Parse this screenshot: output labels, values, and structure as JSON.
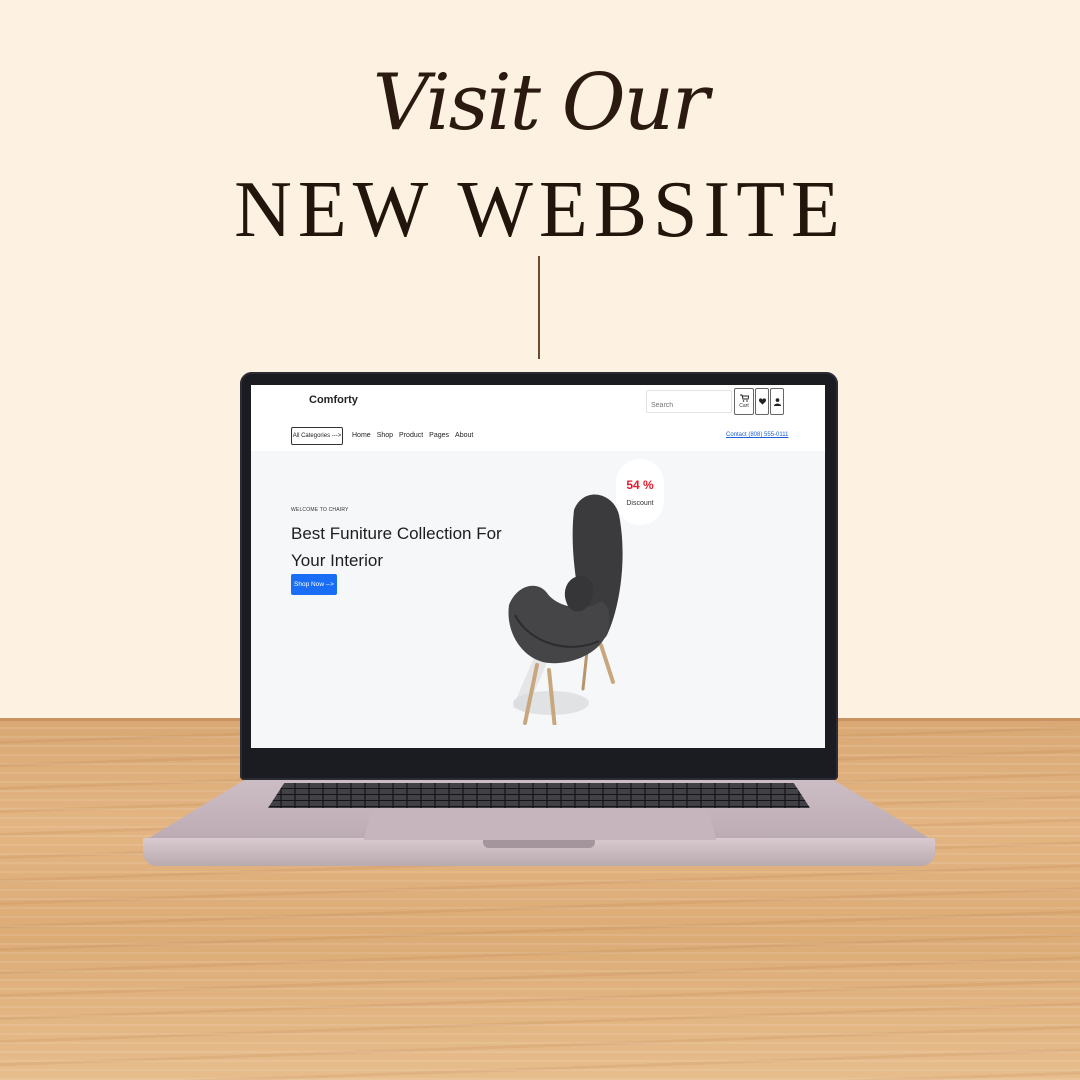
{
  "poster": {
    "headline_script": "Visit Our",
    "headline_caps": "NEW WEBSITE"
  },
  "website": {
    "logo": "Comforty",
    "search": {
      "placeholder": "Search"
    },
    "cart_label": "Cart",
    "icons": [
      "cart-icon",
      "heart-icon",
      "user-icon"
    ],
    "categories_button": "All Categories --->",
    "nav": [
      "Home",
      "Shop",
      "Product",
      "Pages",
      "About"
    ],
    "contact": "Contact (808) 555-0111",
    "hero": {
      "eyebrow": "WELCOME TO CHAIRY",
      "title": "Best Funiture Collection For Your Interior",
      "cta": "Shop Now -->",
      "discount_value": "54 %",
      "discount_label": "Discount"
    },
    "colors": {
      "accent": "#1a6ef5",
      "discount": "#e21d2b",
      "background": "#fdf1e1"
    }
  }
}
